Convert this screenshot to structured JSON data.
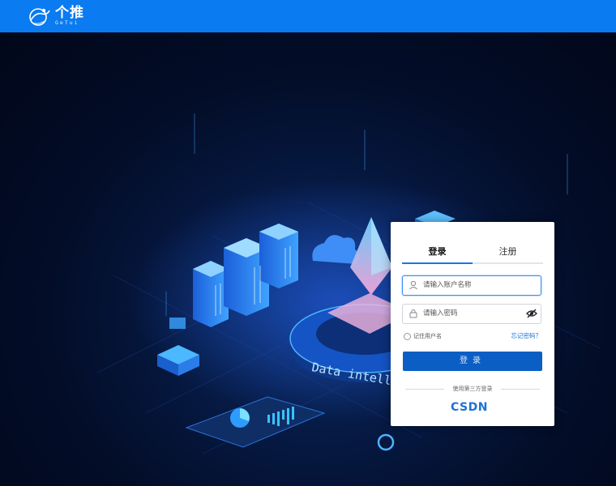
{
  "brand": {
    "name_cn": "个推",
    "name_en": "GeTui",
    "color": "#0a7bf0"
  },
  "hero": {
    "banner_text": "Data intellig"
  },
  "login": {
    "tabs": [
      {
        "label": "登录",
        "active": true
      },
      {
        "label": "注册",
        "active": false
      }
    ],
    "username_placeholder": "请输入账户名称",
    "password_placeholder": "请输入密码",
    "remember_label": "记住用户名",
    "forgot_label": "忘记密码？",
    "submit_label": "登录",
    "third_party_label": "使用第三方登录",
    "third_party_providers": [
      {
        "name": "CSDN"
      }
    ],
    "accent_color": "#0b5fc4"
  }
}
